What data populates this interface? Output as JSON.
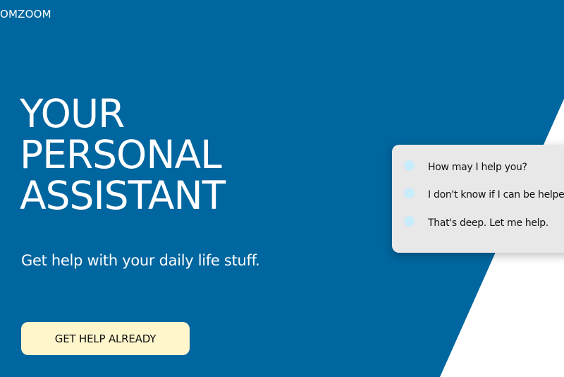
{
  "brand": {
    "logo_text": "OMZOOM"
  },
  "hero": {
    "title_lines": [
      "YOUR",
      "PERSONAL",
      "ASSISTANT"
    ],
    "subtitle": "Get help with your daily life stuff.",
    "cta_label": "GET HELP ALREADY"
  },
  "chat": {
    "messages": [
      {
        "text": "How may I help you?"
      },
      {
        "text": "I don't know if I can be helped"
      },
      {
        "text": "That's deep. Let me help."
      }
    ]
  },
  "colors": {
    "background": "#00669f",
    "white_panel": "#ffffff",
    "cta_background": "#fff6cc",
    "chat_background": "#e8e8e8",
    "chat_dot": "#c9ecfb"
  }
}
